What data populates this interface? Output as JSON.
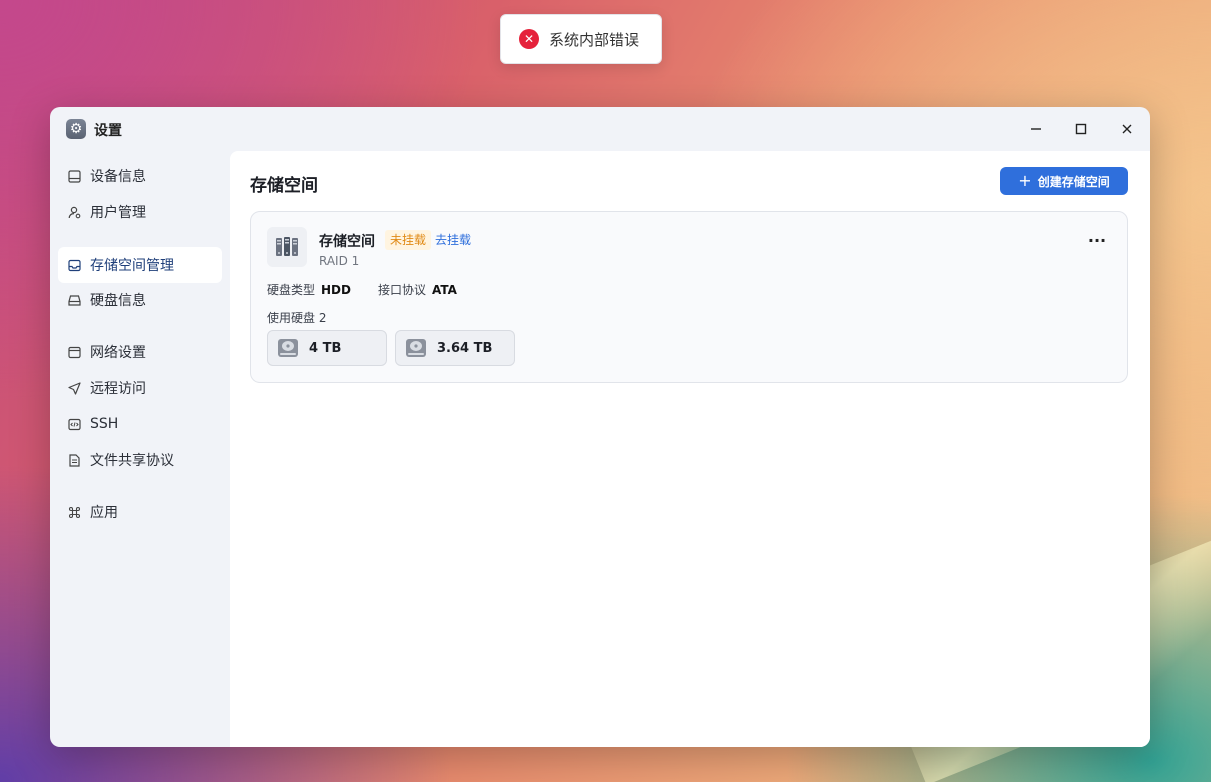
{
  "toast": {
    "message": "系统内部错误",
    "icon": "error-circle-icon",
    "color": "#e5223b"
  },
  "window": {
    "title": "设置",
    "controls": [
      "minimize-icon",
      "maximize-icon",
      "close-icon"
    ]
  },
  "sidebar": {
    "items": [
      {
        "label": "设备信息",
        "icon": "device-icon"
      },
      {
        "label": "用户管理",
        "icon": "user-icon"
      },
      {
        "label": "存储空间管理",
        "icon": "storage-icon",
        "active": true
      },
      {
        "label": "硬盘信息",
        "icon": "hard-drive-icon"
      },
      {
        "label": "网络设置",
        "icon": "network-icon"
      },
      {
        "label": "远程访问",
        "icon": "send-icon"
      },
      {
        "label": "SSH",
        "icon": "code-icon"
      },
      {
        "label": "文件共享协议",
        "icon": "file-icon"
      },
      {
        "label": "应用",
        "icon": "command-icon"
      }
    ]
  },
  "main": {
    "title": "存储空间",
    "create_button": "创建存储空间",
    "accent": "#2f6fdc",
    "storage": {
      "name": "存储空间",
      "status_badge": "未挂载",
      "mount_link": "去挂载",
      "raid": "RAID 1",
      "disk_type_label": "硬盘类型",
      "disk_type_value": "HDD",
      "interface_label": "接口协议",
      "interface_value": "ATA",
      "used_disks_label": "使用硬盘 2",
      "more": "...",
      "disks": [
        {
          "size": "4 TB",
          "icon": "hdd-icon"
        },
        {
          "size": "3.64 TB",
          "icon": "hdd-icon"
        }
      ]
    }
  }
}
